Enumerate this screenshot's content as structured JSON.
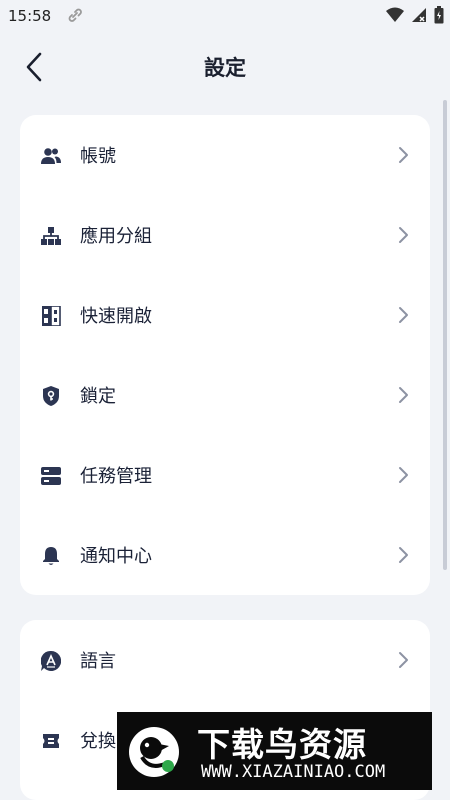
{
  "status_bar": {
    "time": "15:58"
  },
  "header": {
    "title": "設定"
  },
  "card1": {
    "items": [
      {
        "label": "帳號",
        "icon": "account-users-icon"
      },
      {
        "label": "應用分組",
        "icon": "app-group-icon"
      },
      {
        "label": "快速開啟",
        "icon": "quick-open-icon"
      },
      {
        "label": "鎖定",
        "icon": "lock-shield-icon"
      },
      {
        "label": "任務管理",
        "icon": "task-management-icon"
      },
      {
        "label": "通知中心",
        "icon": "notification-bell-icon"
      }
    ]
  },
  "card2": {
    "items": [
      {
        "label": "語言",
        "icon": "language-icon"
      },
      {
        "label": "兌換",
        "icon": "redeem-icon"
      }
    ]
  },
  "watermark": {
    "title": "下载鸟资源",
    "url": "WWW.XIAZAINIAO.COM"
  },
  "colors": {
    "background": "#f1f3f7",
    "card": "#ffffff",
    "icon": "#2c3552",
    "chevron": "#8d93a3",
    "text": "#1b2237"
  }
}
